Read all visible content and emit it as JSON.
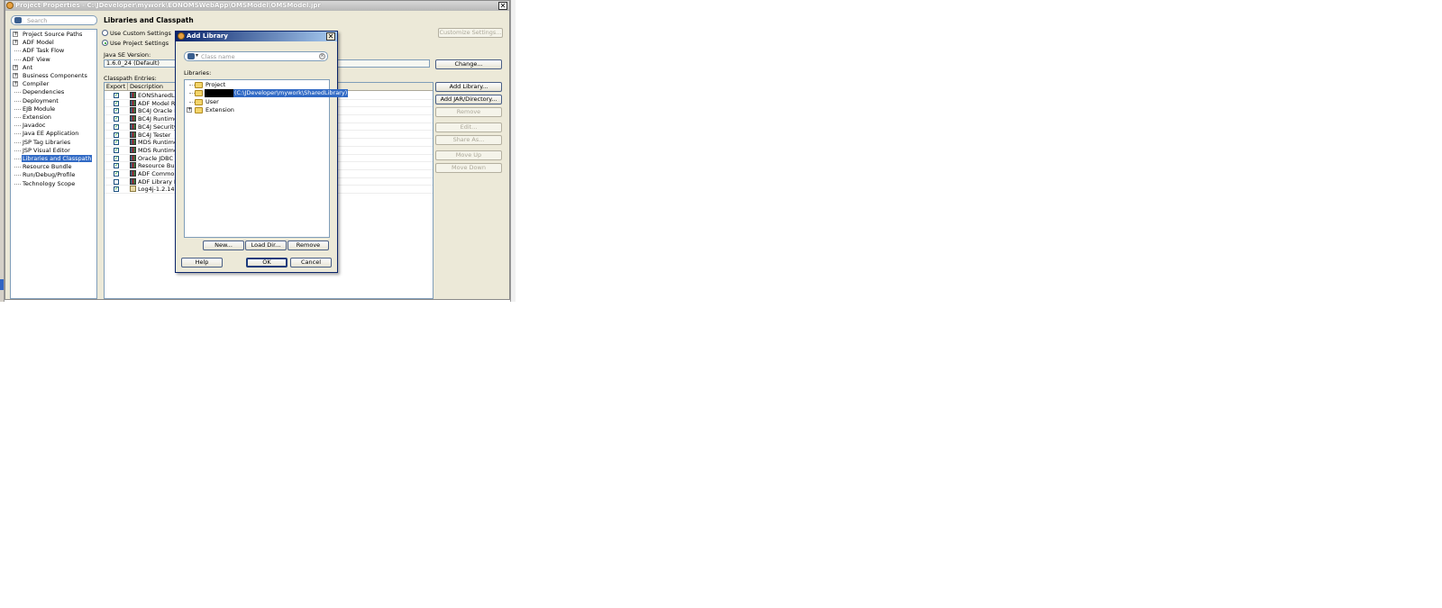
{
  "window": {
    "title": "Project Properties - C:\\JDeveloper\\mywork\\EONOMSWebApp\\OMSModel\\OMSModel.jpr",
    "close": "✕"
  },
  "search": {
    "placeholder": "Search"
  },
  "nav_tree": [
    {
      "label": "Project Source Paths",
      "expandable": true
    },
    {
      "label": "ADF Model",
      "expandable": true
    },
    {
      "label": "ADF Task Flow",
      "expandable": false
    },
    {
      "label": "ADF View",
      "expandable": false
    },
    {
      "label": "Ant",
      "expandable": true
    },
    {
      "label": "Business Components",
      "expandable": true
    },
    {
      "label": "Compiler",
      "expandable": true
    },
    {
      "label": "Dependencies",
      "expandable": false
    },
    {
      "label": "Deployment",
      "expandable": false
    },
    {
      "label": "EJB Module",
      "expandable": false
    },
    {
      "label": "Extension",
      "expandable": false
    },
    {
      "label": "Javadoc",
      "expandable": false
    },
    {
      "label": "Java EE Application",
      "expandable": false
    },
    {
      "label": "JSP Tag Libraries",
      "expandable": false
    },
    {
      "label": "JSP Visual Editor",
      "expandable": false
    },
    {
      "label": "Libraries and Classpath",
      "expandable": false,
      "selected": true
    },
    {
      "label": "Resource Bundle",
      "expandable": false
    },
    {
      "label": "Run/Debug/Profile",
      "expandable": false
    },
    {
      "label": "Technology Scope",
      "expandable": false
    }
  ],
  "main": {
    "section_title": "Libraries and Classpath",
    "use_custom_settings": "Use Custom Settings",
    "use_project_settings": "Use Project Settings",
    "customize_settings": "Customize Settings...",
    "java_se_label": "Java SE Version:",
    "java_se_value": "1.6.0_24 (Default)",
    "change": "Change...",
    "classpath_label": "Classpath Entries:",
    "col_export": "Export",
    "col_description": "Description",
    "entries": [
      {
        "name": "EONSharedLib.jar",
        "checked": true,
        "type": "lib"
      },
      {
        "name": "ADF Model Runtime",
        "checked": true,
        "type": "lib"
      },
      {
        "name": "BC4J Oracle Domains",
        "checked": true,
        "type": "lib"
      },
      {
        "name": "BC4J Runtime",
        "checked": true,
        "type": "lib"
      },
      {
        "name": "BC4J Security",
        "checked": true,
        "type": "lib"
      },
      {
        "name": "BC4J Tester",
        "checked": true,
        "type": "lib"
      },
      {
        "name": "MDS Runtime",
        "checked": true,
        "type": "lib"
      },
      {
        "name": "MDS Runtime Dependencies",
        "checked": true,
        "type": "lib"
      },
      {
        "name": "Oracle JDBC",
        "checked": true,
        "type": "lib"
      },
      {
        "name": "Resource Bundle Support",
        "checked": true,
        "type": "lib"
      },
      {
        "name": "ADF Common Runtime",
        "checked": true,
        "type": "lib"
      },
      {
        "name": "ADF Library Dependencies",
        "checked": false,
        "type": "lib"
      },
      {
        "name": "Log4j-1.2.14.jar",
        "checked": true,
        "type": "jar"
      }
    ],
    "buttons": {
      "add_library": "Add Library...",
      "add_jar": "Add JAR/Directory...",
      "remove": "Remove",
      "edit": "Edit...",
      "share_as": "Share As...",
      "move_up": "Move Up",
      "move_down": "Move Down"
    }
  },
  "dialog": {
    "title": "Add Library",
    "close": "✕",
    "search_placeholder": "Class name",
    "libraries_label": "Libraries:",
    "tree": [
      {
        "label": "Project",
        "expandable": false
      },
      {
        "label": "(C:\\JDeveloper\\mywork\\SharedLibrary)",
        "expandable": false,
        "selected": true,
        "redacted_prefix": true
      },
      {
        "label": "User",
        "expandable": false
      },
      {
        "label": "Extension",
        "expandable": true
      }
    ],
    "new": "New...",
    "load_dir": "Load Dir...",
    "remove": "Remove",
    "help": "Help",
    "ok": "OK",
    "cancel": "Cancel"
  }
}
